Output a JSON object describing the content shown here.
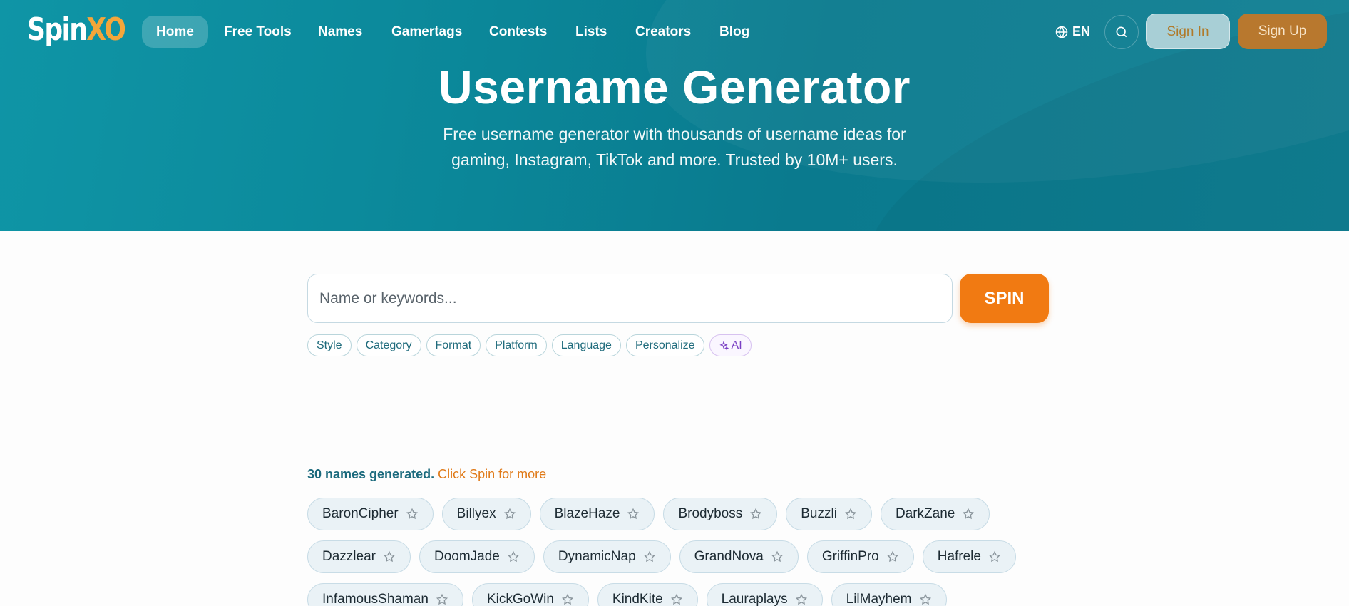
{
  "logo": {
    "part1": "Spin",
    "part2": "XO"
  },
  "nav": {
    "items": [
      {
        "label": "Home",
        "active": true
      },
      {
        "label": "Free Tools"
      },
      {
        "label": "Names"
      },
      {
        "label": "Gamertags"
      },
      {
        "label": "Contests"
      },
      {
        "label": "Lists"
      },
      {
        "label": "Creators"
      },
      {
        "label": "Blog"
      }
    ],
    "language": "EN",
    "sign_in": "Sign In",
    "sign_up": "Sign Up"
  },
  "hero": {
    "title": "Username Generator",
    "subtitle_line1": "Free username generator with thousands of username ideas for",
    "subtitle_line2": "gaming, Instagram, TikTok and more. Trusted by 10M+ users."
  },
  "search": {
    "placeholder": "Name or keywords...",
    "value": "",
    "button": "SPIN"
  },
  "filters": [
    "Style",
    "Category",
    "Format",
    "Platform",
    "Language",
    "Personalize",
    "AI"
  ],
  "results": {
    "count_text": "30 names generated.",
    "more_text": "Click Spin for more",
    "names": [
      [
        "BaronCipher",
        "Billyex",
        "BlazeHaze",
        "Brodyboss",
        "Buzzli",
        "DarkZane"
      ],
      [
        "Dazzlear",
        "DoomJade",
        "DynamicNap",
        "GrandNova",
        "GriffinPro",
        "Hafrele"
      ],
      [
        "InfamousShaman",
        "KickGoWin",
        "KindKite",
        "Lauraplays",
        "LilMayhem"
      ]
    ]
  },
  "colors": {
    "hero_bg": "#0b8799",
    "accent_orange": "#f17a12",
    "link_orange": "#e07a18",
    "teal_text": "#1b6a7d"
  }
}
